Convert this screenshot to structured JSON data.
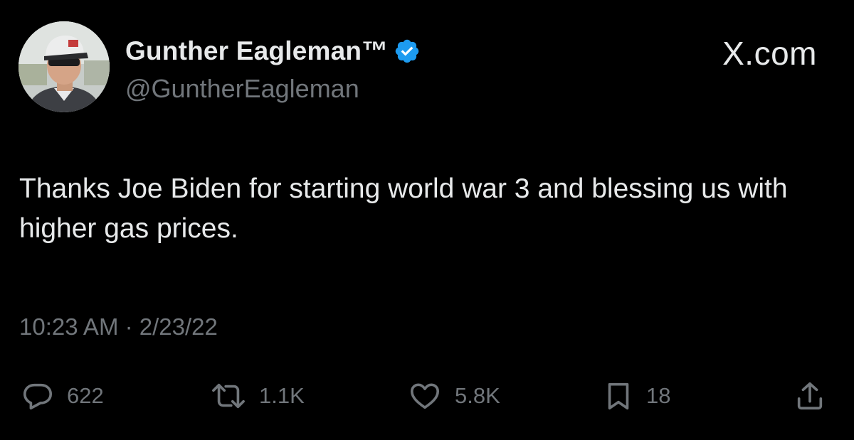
{
  "author": {
    "display_name": "Gunther Eagleman™",
    "handle": "@GuntherEagleman",
    "verified": true,
    "verified_color": "#1d9bf0"
  },
  "source": "X.com",
  "tweet": {
    "text": "Thanks Joe Biden for starting world war 3 and blessing us with higher gas prices.",
    "timestamp": "10:23 AM · 2/23/22"
  },
  "actions": {
    "replies": "622",
    "reposts": "1.1K",
    "likes": "5.8K",
    "bookmarks": "18"
  },
  "icons": {
    "reply": "speech-bubble-icon",
    "repost": "repost-arrows-icon",
    "like": "heart-icon",
    "bookmark": "bookmark-icon",
    "share": "share-upload-icon"
  },
  "colors": {
    "background": "#000000",
    "primary_text": "#e7e9ea",
    "secondary_text": "#71767b"
  }
}
